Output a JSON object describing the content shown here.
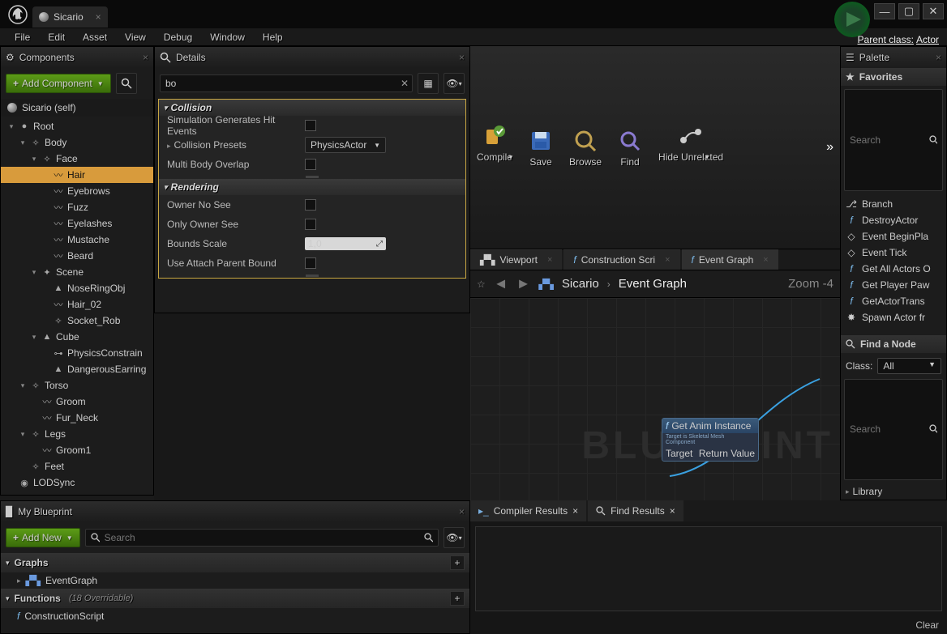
{
  "titlebar": {
    "tab_name": "Sicario",
    "parent_class_label": "Parent class:",
    "parent_class_value": "Actor"
  },
  "menubar": [
    "File",
    "Edit",
    "Asset",
    "View",
    "Debug",
    "Window",
    "Help"
  ],
  "components": {
    "title": "Components",
    "add_label": "Add Component",
    "self_label": "Sicario (self)",
    "tree": [
      {
        "label": "Root",
        "depth": 0,
        "arrow": "▾",
        "icon": "sphere"
      },
      {
        "label": "Body",
        "depth": 1,
        "arrow": "▾",
        "icon": "bone"
      },
      {
        "label": "Face",
        "depth": 2,
        "arrow": "▾",
        "icon": "bone"
      },
      {
        "label": "Hair",
        "depth": 3,
        "arrow": "",
        "icon": "feather",
        "selected": true
      },
      {
        "label": "Eyebrows",
        "depth": 3,
        "arrow": "",
        "icon": "feather"
      },
      {
        "label": "Fuzz",
        "depth": 3,
        "arrow": "",
        "icon": "feather"
      },
      {
        "label": "Eyelashes",
        "depth": 3,
        "arrow": "",
        "icon": "feather"
      },
      {
        "label": "Mustache",
        "depth": 3,
        "arrow": "",
        "icon": "feather"
      },
      {
        "label": "Beard",
        "depth": 3,
        "arrow": "",
        "icon": "feather"
      },
      {
        "label": "Scene",
        "depth": 2,
        "arrow": "▾",
        "icon": "gizmo"
      },
      {
        "label": "NoseRingObj",
        "depth": 3,
        "arrow": "",
        "icon": "mesh"
      },
      {
        "label": "Hair_02",
        "depth": 3,
        "arrow": "",
        "icon": "feather"
      },
      {
        "label": "Socket_Rob",
        "depth": 3,
        "arrow": "",
        "icon": "bone"
      },
      {
        "label": "Cube",
        "depth": 2,
        "arrow": "▾",
        "icon": "mesh"
      },
      {
        "label": "PhysicsConstrain",
        "depth": 3,
        "arrow": "",
        "icon": "joint"
      },
      {
        "label": "DangerousEarring",
        "depth": 3,
        "arrow": "",
        "icon": "mesh"
      },
      {
        "label": "Torso",
        "depth": 1,
        "arrow": "▾",
        "icon": "bone"
      },
      {
        "label": "Groom",
        "depth": 2,
        "arrow": "",
        "icon": "feather"
      },
      {
        "label": "Fur_Neck",
        "depth": 2,
        "arrow": "",
        "icon": "feather"
      },
      {
        "label": "Legs",
        "depth": 1,
        "arrow": "▾",
        "icon": "bone"
      },
      {
        "label": "Groom1",
        "depth": 2,
        "arrow": "",
        "icon": "feather"
      },
      {
        "label": "Feet",
        "depth": 1,
        "arrow": "",
        "icon": "bone"
      },
      {
        "label": "LODSync",
        "depth": 0,
        "arrow": "",
        "icon": "lod"
      }
    ]
  },
  "details": {
    "title": "Details",
    "search_value": "bo",
    "categories": [
      {
        "name": "Collision",
        "rows": [
          {
            "label": "Simulation Generates Hit Events",
            "type": "check"
          },
          {
            "label": "Collision Presets",
            "type": "combo",
            "value": "PhysicsActor",
            "expandable": true
          },
          {
            "label": "Multi Body Overlap",
            "type": "check"
          }
        ]
      },
      {
        "name": "Rendering",
        "rows": [
          {
            "label": "Owner No See",
            "type": "check"
          },
          {
            "label": "Only Owner See",
            "type": "check"
          },
          {
            "label": "Bounds Scale",
            "type": "number",
            "value": "1,0"
          },
          {
            "label": "Use Attach Parent Bound",
            "type": "check"
          }
        ]
      }
    ]
  },
  "toolbar": [
    {
      "label": "Compile",
      "icon": "compile",
      "dd": true
    },
    {
      "label": "Save",
      "icon": "save"
    },
    {
      "label": "Browse",
      "icon": "browse"
    },
    {
      "label": "Find",
      "icon": "find"
    },
    {
      "label": "Hide Unrelated",
      "icon": "hide",
      "dd": true
    }
  ],
  "graph": {
    "tabs": [
      {
        "label": "Viewport",
        "icon": "grid"
      },
      {
        "label": "Construction Scri",
        "icon": "f"
      },
      {
        "label": "Event Graph",
        "icon": "f",
        "active": true
      }
    ],
    "crumb_root": "Sicario",
    "crumb_leaf": "Event Graph",
    "zoom": "Zoom -4",
    "watermark": "BLUEPRINT",
    "node": {
      "title": "Get Anim Instance",
      "sub": "Target is Skeletal Mesh Component",
      "pin_l": "Target",
      "pin_r": "Return Value"
    }
  },
  "mybp": {
    "title": "My Blueprint",
    "add_label": "Add New",
    "search_placeholder": "Search",
    "graphs_label": "Graphs",
    "eventgraph_label": "EventGraph",
    "functions_label": "Functions",
    "functions_count": "(18 Overridable)",
    "construction_label": "ConstructionScript"
  },
  "bottom_tabs": {
    "compiler": "Compiler Results",
    "find": "Find Results",
    "clear": "Clear"
  },
  "palette": {
    "title": "Palette",
    "favorites_label": "Favorites",
    "search_placeholder": "Search",
    "items": [
      {
        "label": "Branch",
        "icon": "branch"
      },
      {
        "label": "DestroyActor",
        "icon": "f"
      },
      {
        "label": "Event BeginPla",
        "icon": "event"
      },
      {
        "label": "Event Tick",
        "icon": "event"
      },
      {
        "label": "Get All Actors O",
        "icon": "f"
      },
      {
        "label": "Get Player Paw",
        "icon": "f"
      },
      {
        "label": "GetActorTrans",
        "icon": "f"
      },
      {
        "label": "Spawn Actor fr",
        "icon": "spawn"
      }
    ],
    "find_node_label": "Find a Node",
    "class_label": "Class:",
    "class_value": "All",
    "search2_placeholder": "Search",
    "library_label": "Library"
  }
}
